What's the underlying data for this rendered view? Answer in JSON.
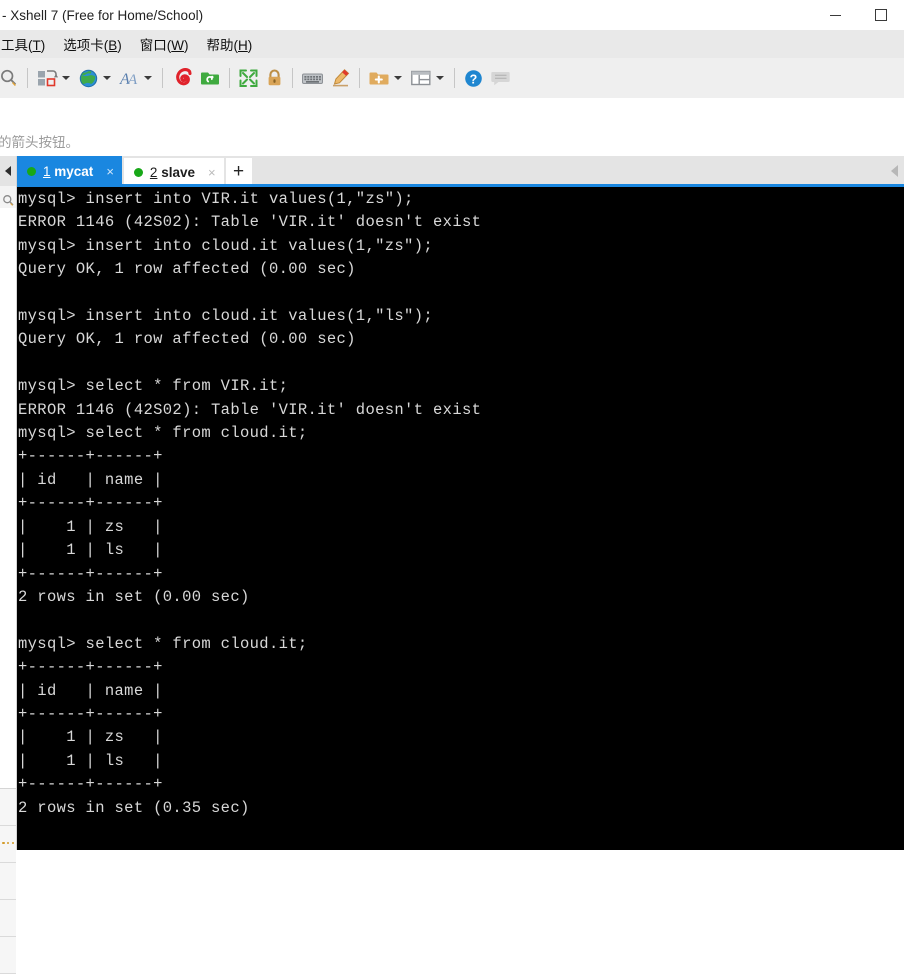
{
  "window": {
    "title": "- Xshell 7 (Free for Home/School)",
    "controls": [
      {
        "name": "minimize",
        "glyph": "minimize-icon"
      },
      {
        "name": "maximize",
        "glyph": "maximize-icon"
      }
    ]
  },
  "menubar": {
    "items": [
      {
        "label": "工具",
        "accel": "T"
      },
      {
        "label": "选项卡",
        "accel": "B"
      },
      {
        "label": "窗口",
        "accel": "W"
      },
      {
        "label": "帮助",
        "accel": "H"
      }
    ]
  },
  "toolbar": {
    "items": [
      {
        "name": "find-icon",
        "tooltip": "查找"
      },
      {
        "name": "transfer-icon",
        "tooltip": "传输",
        "caret": true
      },
      {
        "name": "globe-icon",
        "tooltip": "会话",
        "caret": true
      },
      {
        "name": "font-icon",
        "tooltip": "字体",
        "caret": true
      },
      {
        "name": "xshell-icon",
        "tooltip": "Xshell"
      },
      {
        "name": "xftp-icon",
        "tooltip": "Xftp"
      },
      {
        "name": "fullscreen-icon",
        "tooltip": "全屏"
      },
      {
        "name": "lock-icon",
        "tooltip": "锁定"
      },
      {
        "name": "keyboard-icon",
        "tooltip": "键盘"
      },
      {
        "name": "highlight-icon",
        "tooltip": "高亮"
      },
      {
        "name": "new-folder-icon",
        "tooltip": "新建文件夹",
        "caret": true
      },
      {
        "name": "layout-icon",
        "tooltip": "排列",
        "caret": true
      },
      {
        "name": "help-icon",
        "tooltip": "帮助"
      },
      {
        "name": "comment-icon",
        "tooltip": "反馈"
      }
    ]
  },
  "hint": {
    "text": "的箭头按钮。"
  },
  "left_rail": {
    "collapse": "chevron-left-icon",
    "search": "search-icon",
    "more": "more-dots-icon"
  },
  "tabbar": {
    "tabs": [
      {
        "index": "1",
        "name": "mycat",
        "status": "connected",
        "active": true,
        "close": "×"
      },
      {
        "index": "2",
        "name": "slave",
        "status": "connected",
        "active": false,
        "close": "×"
      }
    ],
    "add_label": "+",
    "scroll_left": "chevron-left-icon",
    "accent": "#1a87e0"
  },
  "terminal": {
    "colors": {
      "background": "#000000",
      "foreground": "#d8d8d8"
    },
    "content": "mysql> insert into VIR.it values(1,\"zs\");\nERROR 1146 (42S02): Table 'VIR.it' doesn't exist\nmysql> insert into cloud.it values(1,\"zs\");\nQuery OK, 1 row affected (0.00 sec)\n\nmysql> insert into cloud.it values(1,\"ls\");\nQuery OK, 1 row affected (0.00 sec)\n\nmysql> select * from VIR.it;\nERROR 1146 (42S02): Table 'VIR.it' doesn't exist\nmysql> select * from cloud.it;\n+------+------+\n| id   | name |\n+------+------+\n|    1 | zs   |\n|    1 | ls   |\n+------+------+\n2 rows in set (0.00 sec)\n\nmysql> select * from cloud.it;\n+------+------+\n| id   | name |\n+------+------+\n|    1 | zs   |\n|    1 | ls   |\n+------+------+\n2 rows in set (0.35 sec)"
  }
}
